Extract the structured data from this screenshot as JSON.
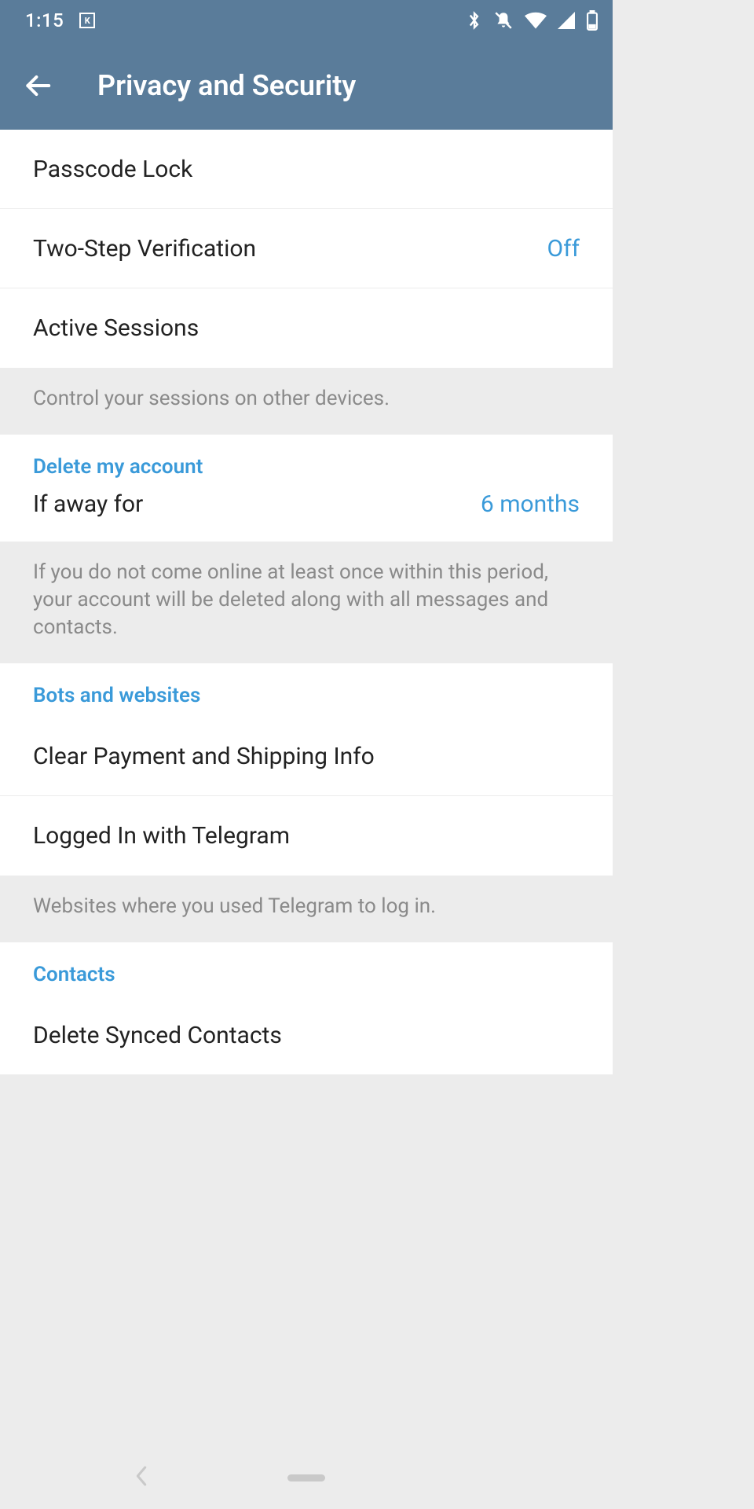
{
  "status": {
    "time": "1:15",
    "k_badge": "K"
  },
  "header": {
    "title": "Privacy and Security"
  },
  "section_security": {
    "passcode": "Passcode Lock",
    "two_step_label": "Two-Step Verification",
    "two_step_value": "Off",
    "active_sessions": "Active Sessions",
    "sessions_info": "Control your sessions on other devices."
  },
  "section_delete": {
    "header": "Delete my account",
    "if_away_label": "If away for",
    "if_away_value": "6 months",
    "info": "If you do not come online at least once within this period, your account will be deleted along with all messages and contacts."
  },
  "section_bots": {
    "header": "Bots and websites",
    "clear_payment": "Clear Payment and Shipping Info",
    "logged_in": "Logged In with Telegram",
    "info": "Websites where you used Telegram to log in."
  },
  "section_contacts": {
    "header": "Contacts",
    "delete_synced": "Delete Synced Contacts"
  }
}
